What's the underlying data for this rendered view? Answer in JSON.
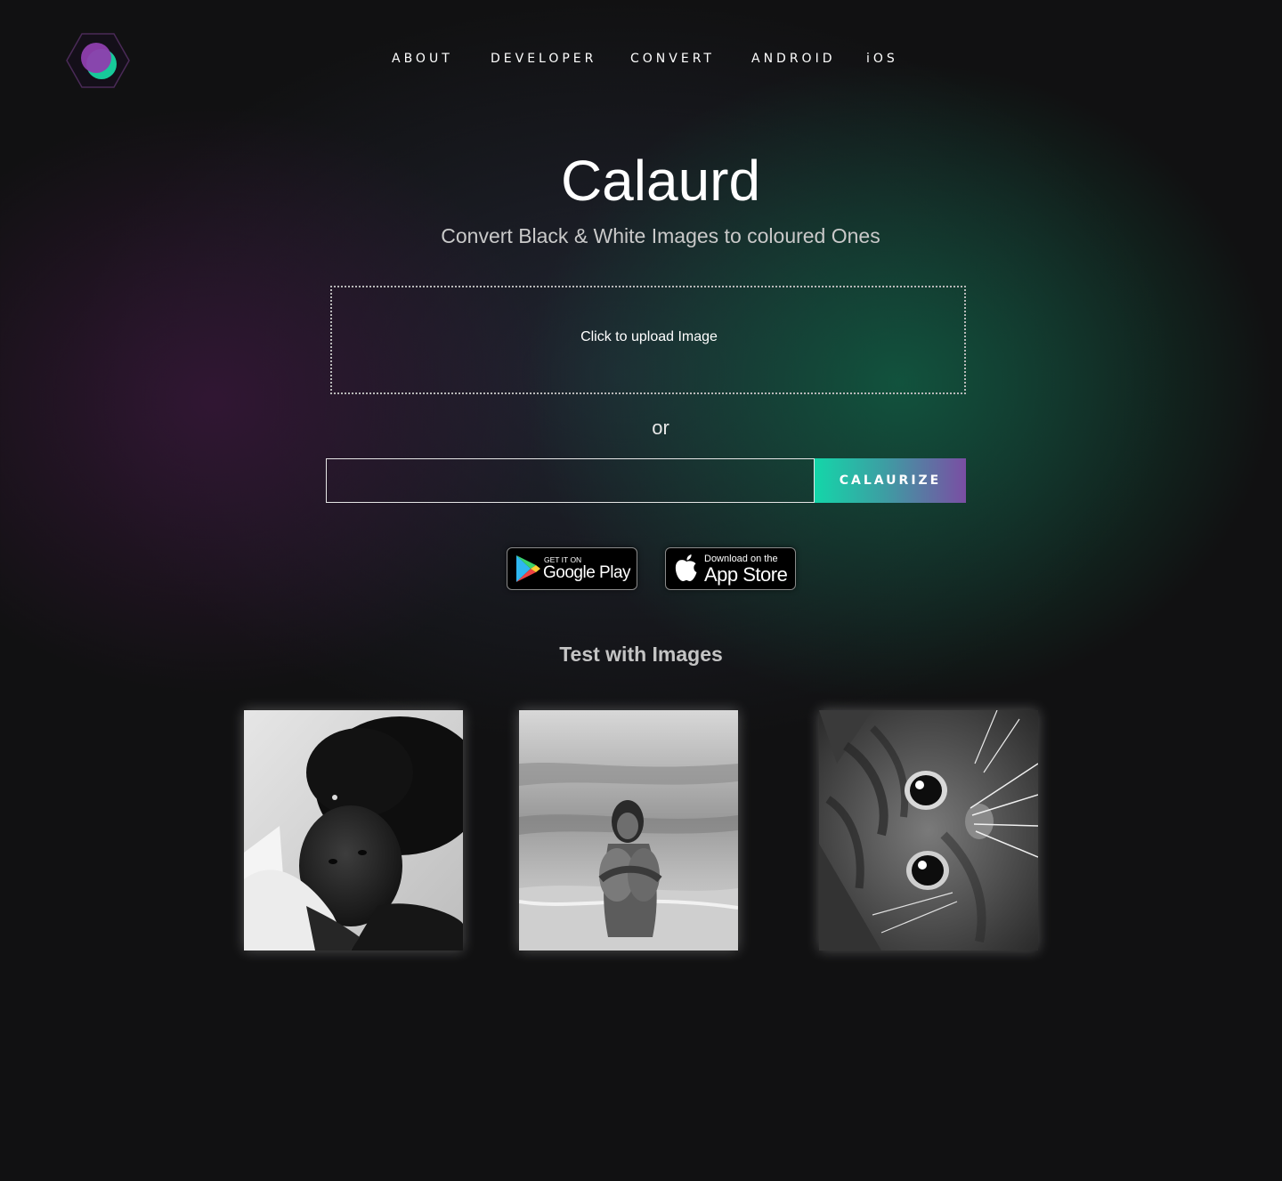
{
  "header": {
    "logo_icon": "calaurd-hexagon-logo",
    "nav": [
      {
        "label": "ABOUT"
      },
      {
        "label": "DEVELOPER"
      },
      {
        "label": "CONVERT"
      },
      {
        "label": "ANDROID"
      },
      {
        "label": "iOS"
      }
    ]
  },
  "hero": {
    "title": "Calaurd",
    "subtitle": "Convert Black & White Images to coloured Ones"
  },
  "upload": {
    "label": "Click to upload Image",
    "or_text": "or",
    "url_value": "",
    "button_label": "CALAURIZE"
  },
  "stores": {
    "google_play": {
      "small": "GET IT ON",
      "big": "Google Play"
    },
    "app_store": {
      "small": "Download on the",
      "big": "App Store"
    }
  },
  "samples": {
    "title": "Test with Images"
  },
  "colors": {
    "background": "#111112",
    "accent_green": "#14d6a9",
    "accent_purple": "#7a4ea3"
  }
}
